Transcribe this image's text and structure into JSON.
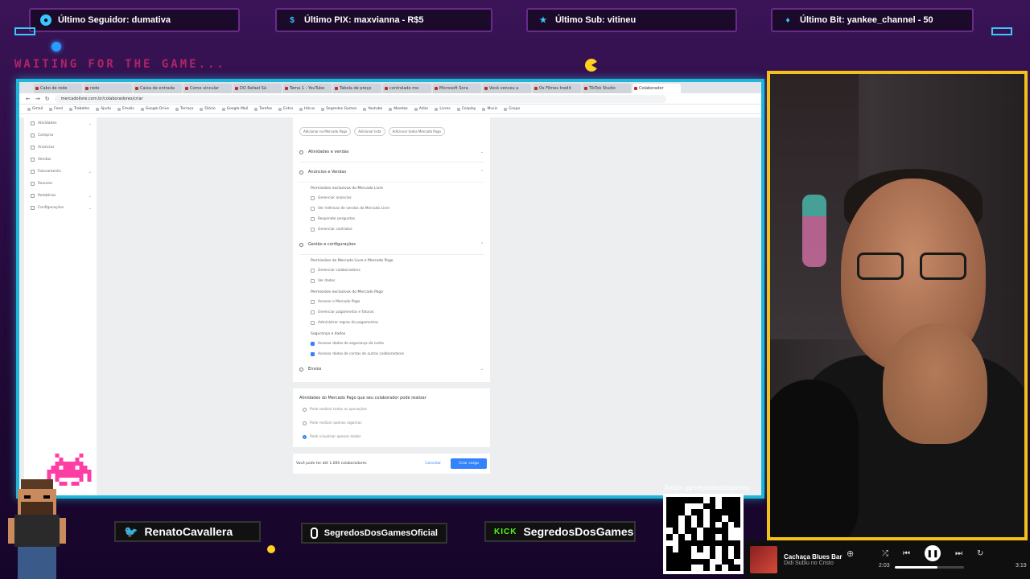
{
  "alerts": [
    {
      "label": "Último Seguidor: dumativa",
      "icon": "user-icon",
      "color": "#38c8ff"
    },
    {
      "label": "Último PIX: maxvianna - R$5",
      "icon": "dollar-icon",
      "color": "#38c8ff"
    },
    {
      "label": "Último Sub: vitineu",
      "icon": "star-icon",
      "color": "#38c8ff"
    },
    {
      "label": "Último Bit: yankee_channel - 50",
      "icon": "diamond-icon",
      "color": "#38c8ff"
    }
  ],
  "waiting_text": "WAITING FOR THE GAME...",
  "browser": {
    "tabs": [
      "Cabo de rede",
      "redo",
      "Caixa de entrada",
      "Como vincular",
      "DO Rafael Sá",
      "Tema 1 - YouTube",
      "Tabela de preço",
      "controlado me",
      "Microsoft Sora",
      "Você venceu a",
      "Os Filmes Inedit",
      "TikTok Studio",
      "Colaborador"
    ],
    "url": "mercadolivre.com.br/colaboradores/criar",
    "bookmarks": [
      "Gmail",
      "Feed",
      "Trabalho",
      "Ajuda",
      "Emails",
      "Google Drive",
      "Terraço",
      "Diário",
      "Google Mail",
      "Tarefas",
      "Extra",
      "Hórus",
      "Segredos Games",
      "Youtube",
      "Moedas",
      "Adiar",
      "Livros",
      "Cosplay",
      "Music",
      "Grupo"
    ],
    "sidebar": [
      "Atividades",
      "Comprar",
      "Anúncios",
      "Vendas",
      "Faturamento",
      "Resumo",
      "Relatórios",
      "Configurações"
    ],
    "pills": [
      "Adicionar no Mercado Pago",
      "Adicionar lista",
      "Adicionar todos Mercado Pago"
    ],
    "sections": {
      "s1": "Atividades e vendas",
      "s2": "Anúncios e Vendas",
      "s2_sub": "Permissões exclusivas do Mercado Livre",
      "s2_items": [
        "Gerenciar anúncios",
        "Ver métricas de vendas do Mercado Livre",
        "Responder perguntas",
        "Gerenciar contratos"
      ],
      "s3": "Gestão e configurações",
      "s3_sub1": "Permissões do Mercado Livre e Mercado Pago",
      "s3_items1": [
        "Gerenciar colaboradores",
        "Ver dados"
      ],
      "s3_sub2": "Permissões exclusivas do Mercado Pago",
      "s3_items2": [
        "Acessar o Mercado Pago",
        "Gerenciar pagamentos e faturas",
        "Administrar regras de pagamentos"
      ],
      "s3_sub3": "Segurança e dados",
      "s3_checked": [
        "Acessar dados de segurança da conta",
        "Acessar dados de contas de outros colaboradores"
      ],
      "s4": "Envios"
    },
    "radio_title": "Atividades do Mercado Pago que seu colaborador pode realizar",
    "radios": [
      "Pode realizar todas as operações",
      "Pode realizar apenas algumas",
      "Pode visualizar apenas dados"
    ],
    "footer_text": "Você pode ter até 1.000 colaboradores",
    "cancel_label": "Cancelar",
    "primary_label": "Criar cargo"
  },
  "social": {
    "twitter": "RenatoCavallera",
    "instagram": "SegredosDosGamesOficial",
    "kick_badge": "KICK",
    "kick": "SegredosDosGames"
  },
  "qr_url": "livepix.gg/segredosdosgames",
  "music": {
    "title": "Cachaça Blues Bar",
    "artist": "Didi Subiu no Cristo",
    "elapsed": "2:03",
    "duration": "3:19",
    "progress_fraction": 0.62
  },
  "colors": {
    "accent": "#1fb6d8",
    "cam_border": "#f2c21b",
    "brand_blue": "#3483fa"
  }
}
